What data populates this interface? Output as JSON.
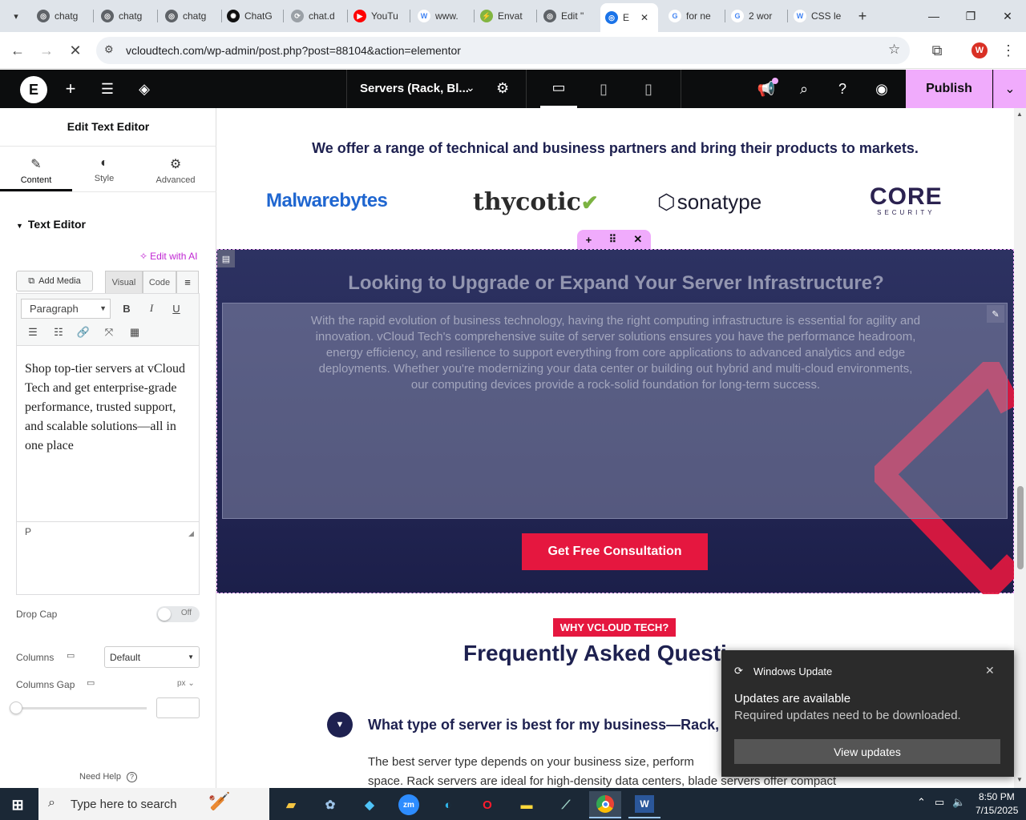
{
  "browser": {
    "tabs": [
      {
        "label": "chatg",
        "color": "#5f6368",
        "glyph": "◎"
      },
      {
        "label": "chatg",
        "color": "#5f6368",
        "glyph": "◎"
      },
      {
        "label": "chatg",
        "color": "#5f6368",
        "glyph": "◎"
      },
      {
        "label": "ChatG",
        "color": "#111111",
        "glyph": "✺"
      },
      {
        "label": "chat.d",
        "color": "#9aa0a6",
        "glyph": "⟳"
      },
      {
        "label": "YouTu",
        "color": "#ff0000",
        "glyph": "▶"
      },
      {
        "label": "www.",
        "color": "#ffffff",
        "glyph": "W"
      },
      {
        "label": "Envat",
        "color": "#82b541",
        "glyph": "⚡"
      },
      {
        "label": "Edit \"",
        "color": "#5f6368",
        "glyph": "◎"
      },
      {
        "label": "E",
        "color": "#1a73e8",
        "glyph": "◎"
      },
      {
        "label": "for ne",
        "color": "#ffffff",
        "glyph": "G"
      },
      {
        "label": "2 wor",
        "color": "#ffffff",
        "glyph": "G"
      },
      {
        "label": "CSS le",
        "color": "#ffffff",
        "glyph": "W"
      }
    ],
    "url": "vcloudtech.com/wp-admin/post.php?post=88104&action=elementor"
  },
  "elementor_top": {
    "doc_title": "Servers (Rack, Bl...",
    "publish_label": "Publish"
  },
  "panel": {
    "title": "Edit Text Editor",
    "tabs": [
      "Content",
      "Style",
      "Advanced"
    ],
    "section_title": "Text Editor",
    "edit_ai": "Edit with AI",
    "add_media": "Add Media",
    "visual_tab": "Visual",
    "code_tab": "Code",
    "paragraph_select": "Paragraph",
    "editor_text": "Shop top-tier servers at vCloud Tech and get enterprise-grade performance, trusted support, and scalable solutions—all in one place",
    "path_label": "P",
    "drop_cap_label": "Drop Cap",
    "drop_cap_value": "Off",
    "columns_label": "Columns",
    "columns_value": "Default",
    "columns_gap_label": "Columns Gap",
    "columns_gap_unit": "px",
    "need_help": "Need Help"
  },
  "canvas": {
    "partners_heading": "We offer a range of technical and business partners and bring their products to markets.",
    "logos": [
      "Malwarebytes",
      "thycotic",
      "sonatype",
      "CORE",
      "SECURITY"
    ],
    "cta_heading": "Looking to Upgrade or Expand Your Server Infrastructure?",
    "cta_body": "With the rapid evolution of business technology, having the right computing infrastructure is essential for agility and innovation. vCloud Tech's comprehensive suite of server solutions ensures you have the performance headroom, energy efficiency, and resilience to support everything from core applications to advanced analytics and edge deployments. Whether you're modernizing your data center or building out hybrid and multi-cloud environments, our computing devices provide a rock-solid foundation for long-term success.",
    "cta_button": "Get Free Consultation",
    "faq_badge": "WHY VCLOUD TECH?",
    "faq_heading": "Frequently Asked Questi",
    "faq_q1": "What type of server is best for my business—Rack,",
    "faq_a1_line1": "The best server type depends on your business size, perform",
    "faq_a1_line2": "space. Rack servers are ideal for high-density data centers, blade servers offer compact"
  },
  "toast": {
    "app": "Windows Update",
    "title": "Updates are available",
    "body": "Required updates need to be downloaded.",
    "button": "View updates"
  },
  "taskbar": {
    "search_placeholder": "Type here to search",
    "time": "8:50 PM",
    "date": "7/15/2025"
  },
  "colors": {
    "elementor_pink": "#f0abfc",
    "cta_red": "#e5173f",
    "navy": "#1e2150",
    "dark": "#0c0d0e"
  }
}
